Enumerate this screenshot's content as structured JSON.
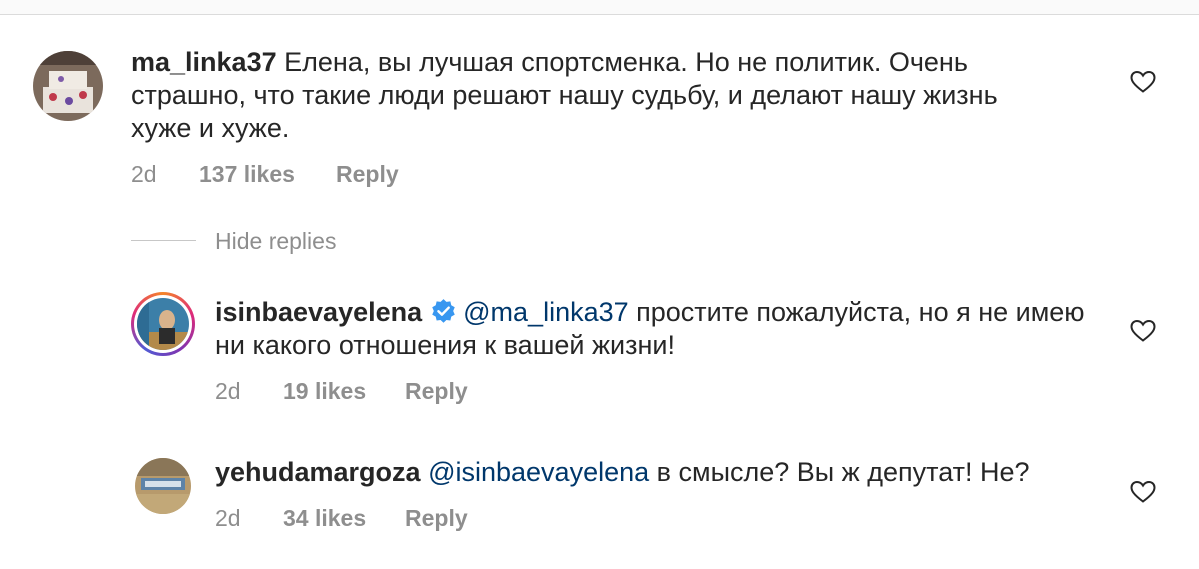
{
  "comments": [
    {
      "username": "ma_linka37",
      "mention": "",
      "text": "Елена, вы лучшая спортсменка. Но не политик. Очень",
      "text_line2": "страшно, что такие люди решают нашу судьбу, и делают нашу жизнь",
      "text_line3": "хуже и хуже.",
      "age": "2d",
      "likes": "137 likes",
      "reply": "Reply",
      "verified": false
    },
    {
      "username": "isinbaevayelena",
      "mention": "@ma_linka37",
      "text": "простите пожалуйста, но я не имею",
      "text_line2": "ни какого отношения к вашей жизни!",
      "age": "2d",
      "likes": "19 likes",
      "reply": "Reply",
      "verified": true
    },
    {
      "username": "yehudamargoza",
      "mention": "@isinbaevayelena",
      "text": "в смысле? Вы ж депутат! Не?",
      "age": "2d",
      "likes": "34 likes",
      "reply": "Reply",
      "verified": false
    }
  ],
  "hide_replies": "Hide replies",
  "icons": {
    "like": "heart-outline-icon",
    "verified": "verified-badge-icon"
  },
  "colors": {
    "mention": "#00376b",
    "meta": "#8e8e8e",
    "verified": "#3897f0",
    "story_ring": "#c13584"
  }
}
